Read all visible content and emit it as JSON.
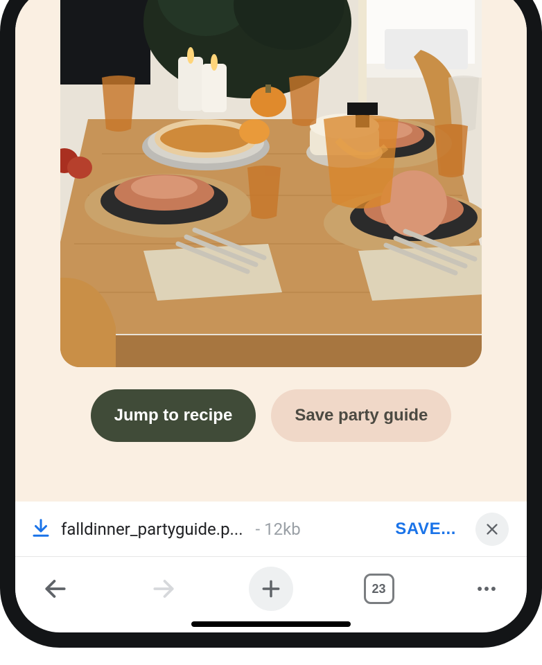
{
  "hero": {
    "alt": "Fall dinner party table with pumpkin pie, candles, pumpkins, amber glasses, terracotta plates on a wooden table"
  },
  "actions": {
    "primary_label": "Jump to recipe",
    "secondary_label": "Save party guide"
  },
  "download": {
    "icon": "download-icon",
    "filename": "falldinner_partyguide.p...",
    "size_prefix": "- ",
    "size": "12kb",
    "save_label": "SAVE..."
  },
  "browser_nav": {
    "tabs_count": "23"
  }
}
